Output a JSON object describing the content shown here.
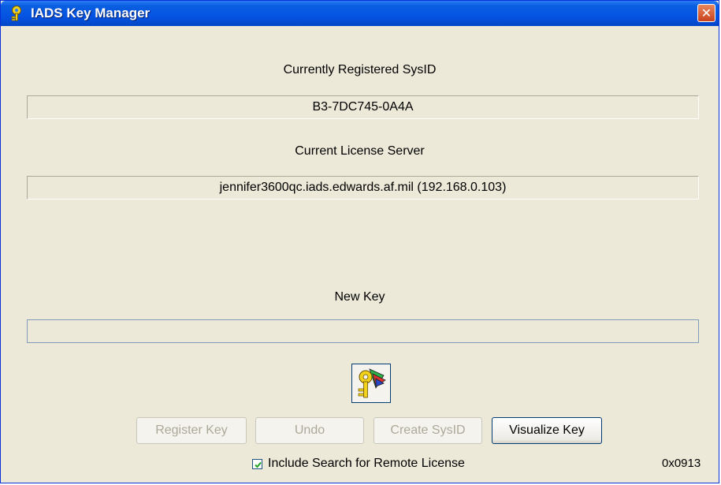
{
  "window": {
    "title": "IADS Key Manager",
    "close_glyph": "✕"
  },
  "sections": {
    "sysid_label": "Currently Registered SysID",
    "sysid_value": "B3-7DC745-0A4A",
    "server_label": "Current License Server",
    "server_value": "jennifer3600qc.iads.edwards.af.mil (192.168.0.103)",
    "newkey_label": "New Key",
    "newkey_value": ""
  },
  "buttons": {
    "register_key": "Register Key",
    "undo": "Undo",
    "create_sysid": "Create SysID",
    "visualize_key": "Visualize Key"
  },
  "checkbox": {
    "label": "Include Search for Remote License",
    "checked": true
  },
  "version": "0x0913",
  "icons": {
    "title": "key-icon",
    "center": "key-visualize-icon"
  },
  "colors": {
    "titlebar": "#0554e3",
    "close": "#c8431b",
    "dialog": "#ece9d8",
    "key_gold": "#e8c200"
  }
}
